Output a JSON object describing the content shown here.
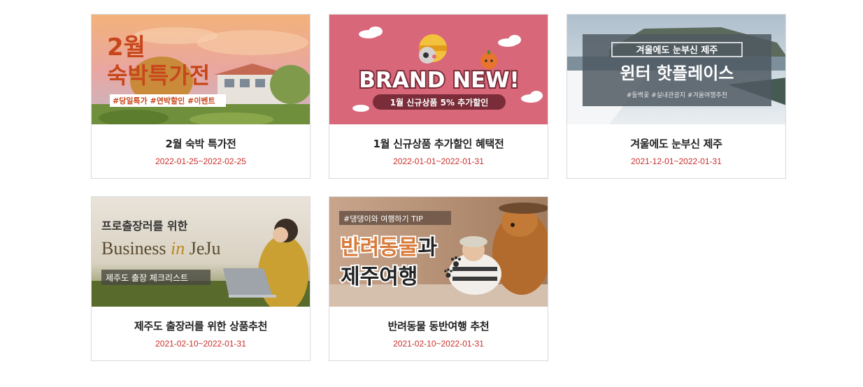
{
  "cards": [
    {
      "title": "2월 숙박 특가전",
      "date": "2022-01-25~2022-02-25",
      "banner": {
        "line1": "2월",
        "line2": "숙박특가전",
        "tags": "#당일특가 #연박할인 #이벤트"
      }
    },
    {
      "title": "1월 신규상품 추가할인 혜택전",
      "date": "2022-01-01~2022-01-31",
      "banner": {
        "headline": "BRAND NEW!",
        "sub": "1월 신규상품 5% 추가할인"
      }
    },
    {
      "title": "겨울에도 눈부신 제주",
      "date": "2021-12-01~2022-01-31",
      "banner": {
        "boxed": "겨울에도 눈부신 제주",
        "headline": "윈터 핫플레이스",
        "tags": "#동백꽃 #실내관광지 #겨울여행추천"
      }
    },
    {
      "title": "제주도 출장러를 위한 상품추천",
      "date": "2021-02-10~2022-01-31",
      "banner": {
        "line1": "프로출장러를 위한",
        "business": "Business ",
        "in": "in ",
        "jeju": "JeJu",
        "sub": "제주도 출장 체크리스트"
      }
    },
    {
      "title": "반려동물 동반여행 추천",
      "date": "2021-02-10~2022-01-31",
      "banner": {
        "tag": "#댕댕이와 여행하기 TIP",
        "line1a": "반려동물",
        "line1b": "과",
        "line2": "제주여행"
      }
    }
  ],
  "colors": {
    "date_red": "#c9302c",
    "banner1_orange": "#c8461b",
    "banner2_pink": "#d9677a",
    "banner5_orange": "#d97b3a"
  }
}
